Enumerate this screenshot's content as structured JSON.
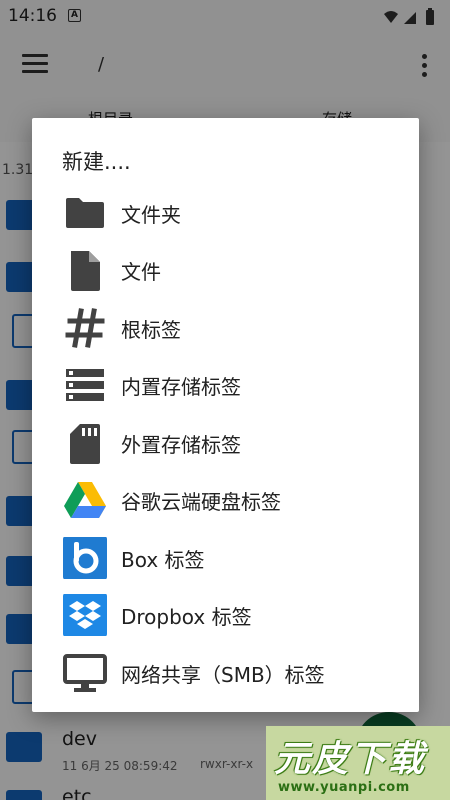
{
  "status_bar": {
    "time": "14:16",
    "notification_icon": "A"
  },
  "app_bar": {
    "path": "/"
  },
  "tabs": [
    "根目录",
    "存储"
  ],
  "list": {
    "size_text": "1.31",
    "rows": [
      {
        "name": "dev",
        "date": "11 6月 25 08:59:42",
        "perm": "rwxr-xr-x"
      },
      {
        "name": "etc"
      }
    ]
  },
  "dialog": {
    "title": "新建....",
    "options": [
      {
        "label": "文件夹",
        "icon": "folder-icon"
      },
      {
        "label": "文件",
        "icon": "file-icon"
      },
      {
        "label": "根标签",
        "icon": "hash-icon"
      },
      {
        "label": "内置存储标签",
        "icon": "storage-icon"
      },
      {
        "label": "外置存储标签",
        "icon": "sd-card-icon"
      },
      {
        "label": "谷歌云端硬盘标签",
        "icon": "google-drive-icon"
      },
      {
        "label": "Box 标签",
        "icon": "box-icon"
      },
      {
        "label": "Dropbox 标签",
        "icon": "dropbox-icon"
      },
      {
        "label": "网络共享（SMB）标签",
        "icon": "monitor-icon"
      }
    ]
  },
  "watermark": {
    "title": "元皮下载",
    "url": "www.yuanpi.com"
  },
  "colors": {
    "accent": "#1565c0",
    "fab": "#0e6a3c",
    "icon_dark": "#424242"
  }
}
